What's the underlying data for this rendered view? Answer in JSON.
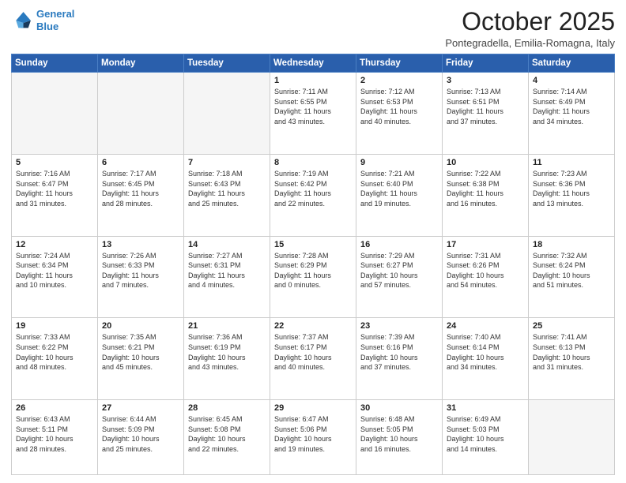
{
  "header": {
    "logo_line1": "General",
    "logo_line2": "Blue",
    "month": "October 2025",
    "location": "Pontegradella, Emilia-Romagna, Italy"
  },
  "weekdays": [
    "Sunday",
    "Monday",
    "Tuesday",
    "Wednesday",
    "Thursday",
    "Friday",
    "Saturday"
  ],
  "weeks": [
    [
      {
        "day": "",
        "info": ""
      },
      {
        "day": "",
        "info": ""
      },
      {
        "day": "",
        "info": ""
      },
      {
        "day": "1",
        "info": "Sunrise: 7:11 AM\nSunset: 6:55 PM\nDaylight: 11 hours\nand 43 minutes."
      },
      {
        "day": "2",
        "info": "Sunrise: 7:12 AM\nSunset: 6:53 PM\nDaylight: 11 hours\nand 40 minutes."
      },
      {
        "day": "3",
        "info": "Sunrise: 7:13 AM\nSunset: 6:51 PM\nDaylight: 11 hours\nand 37 minutes."
      },
      {
        "day": "4",
        "info": "Sunrise: 7:14 AM\nSunset: 6:49 PM\nDaylight: 11 hours\nand 34 minutes."
      }
    ],
    [
      {
        "day": "5",
        "info": "Sunrise: 7:16 AM\nSunset: 6:47 PM\nDaylight: 11 hours\nand 31 minutes."
      },
      {
        "day": "6",
        "info": "Sunrise: 7:17 AM\nSunset: 6:45 PM\nDaylight: 11 hours\nand 28 minutes."
      },
      {
        "day": "7",
        "info": "Sunrise: 7:18 AM\nSunset: 6:43 PM\nDaylight: 11 hours\nand 25 minutes."
      },
      {
        "day": "8",
        "info": "Sunrise: 7:19 AM\nSunset: 6:42 PM\nDaylight: 11 hours\nand 22 minutes."
      },
      {
        "day": "9",
        "info": "Sunrise: 7:21 AM\nSunset: 6:40 PM\nDaylight: 11 hours\nand 19 minutes."
      },
      {
        "day": "10",
        "info": "Sunrise: 7:22 AM\nSunset: 6:38 PM\nDaylight: 11 hours\nand 16 minutes."
      },
      {
        "day": "11",
        "info": "Sunrise: 7:23 AM\nSunset: 6:36 PM\nDaylight: 11 hours\nand 13 minutes."
      }
    ],
    [
      {
        "day": "12",
        "info": "Sunrise: 7:24 AM\nSunset: 6:34 PM\nDaylight: 11 hours\nand 10 minutes."
      },
      {
        "day": "13",
        "info": "Sunrise: 7:26 AM\nSunset: 6:33 PM\nDaylight: 11 hours\nand 7 minutes."
      },
      {
        "day": "14",
        "info": "Sunrise: 7:27 AM\nSunset: 6:31 PM\nDaylight: 11 hours\nand 4 minutes."
      },
      {
        "day": "15",
        "info": "Sunrise: 7:28 AM\nSunset: 6:29 PM\nDaylight: 11 hours\nand 0 minutes."
      },
      {
        "day": "16",
        "info": "Sunrise: 7:29 AM\nSunset: 6:27 PM\nDaylight: 10 hours\nand 57 minutes."
      },
      {
        "day": "17",
        "info": "Sunrise: 7:31 AM\nSunset: 6:26 PM\nDaylight: 10 hours\nand 54 minutes."
      },
      {
        "day": "18",
        "info": "Sunrise: 7:32 AM\nSunset: 6:24 PM\nDaylight: 10 hours\nand 51 minutes."
      }
    ],
    [
      {
        "day": "19",
        "info": "Sunrise: 7:33 AM\nSunset: 6:22 PM\nDaylight: 10 hours\nand 48 minutes."
      },
      {
        "day": "20",
        "info": "Sunrise: 7:35 AM\nSunset: 6:21 PM\nDaylight: 10 hours\nand 45 minutes."
      },
      {
        "day": "21",
        "info": "Sunrise: 7:36 AM\nSunset: 6:19 PM\nDaylight: 10 hours\nand 43 minutes."
      },
      {
        "day": "22",
        "info": "Sunrise: 7:37 AM\nSunset: 6:17 PM\nDaylight: 10 hours\nand 40 minutes."
      },
      {
        "day": "23",
        "info": "Sunrise: 7:39 AM\nSunset: 6:16 PM\nDaylight: 10 hours\nand 37 minutes."
      },
      {
        "day": "24",
        "info": "Sunrise: 7:40 AM\nSunset: 6:14 PM\nDaylight: 10 hours\nand 34 minutes."
      },
      {
        "day": "25",
        "info": "Sunrise: 7:41 AM\nSunset: 6:13 PM\nDaylight: 10 hours\nand 31 minutes."
      }
    ],
    [
      {
        "day": "26",
        "info": "Sunrise: 6:43 AM\nSunset: 5:11 PM\nDaylight: 10 hours\nand 28 minutes."
      },
      {
        "day": "27",
        "info": "Sunrise: 6:44 AM\nSunset: 5:09 PM\nDaylight: 10 hours\nand 25 minutes."
      },
      {
        "day": "28",
        "info": "Sunrise: 6:45 AM\nSunset: 5:08 PM\nDaylight: 10 hours\nand 22 minutes."
      },
      {
        "day": "29",
        "info": "Sunrise: 6:47 AM\nSunset: 5:06 PM\nDaylight: 10 hours\nand 19 minutes."
      },
      {
        "day": "30",
        "info": "Sunrise: 6:48 AM\nSunset: 5:05 PM\nDaylight: 10 hours\nand 16 minutes."
      },
      {
        "day": "31",
        "info": "Sunrise: 6:49 AM\nSunset: 5:03 PM\nDaylight: 10 hours\nand 14 minutes."
      },
      {
        "day": "",
        "info": ""
      }
    ]
  ]
}
